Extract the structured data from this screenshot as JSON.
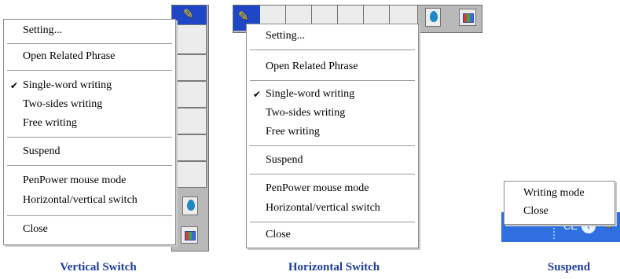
{
  "vertical": {
    "menu": {
      "setting": "Setting...",
      "open_related_phrase": "Open Related Phrase",
      "single_word_writing": "Single-word writing",
      "two_sides_writing": "Two-sides writing",
      "free_writing": "Free writing",
      "suspend": "Suspend",
      "penpower_mouse_mode": "PenPower mouse mode",
      "horizontal_vertical_switch": "Horizontal/vertical switch",
      "close": "Close",
      "checked_item": "Single-word writing",
      "check_mark": "✔"
    },
    "caption": "Vertical Switch"
  },
  "horizontal": {
    "menu": {
      "setting": "Setting...",
      "open_related_phrase": "Open Related Phrase",
      "single_word_writing": "Single-word writing",
      "two_sides_writing": "Two-sides writing",
      "free_writing": "Free writing",
      "suspend": "Suspend",
      "penpower_mouse_mode": "PenPower mouse mode",
      "horizontal_vertical_switch": "Horizontal/vertical switch",
      "close": "Close",
      "checked_item": "Single-word writing",
      "check_mark": "✔"
    },
    "caption": "Horizontal Switch"
  },
  "suspend": {
    "menu": {
      "writing_mode": "Writing mode",
      "close": "Close"
    },
    "taskbar_text": "CE",
    "caption": "Suspend"
  },
  "icons": {
    "pen": "pen-icon",
    "drop": "drop-icon",
    "palette": "palette-icon",
    "arrow": "chevron-left-icon"
  },
  "colors": {
    "pen_button": "#1f46c4",
    "caption": "#1f3d9e",
    "taskbar": "#2f6fe0",
    "toolbar_frame": "#b9b9b9"
  }
}
